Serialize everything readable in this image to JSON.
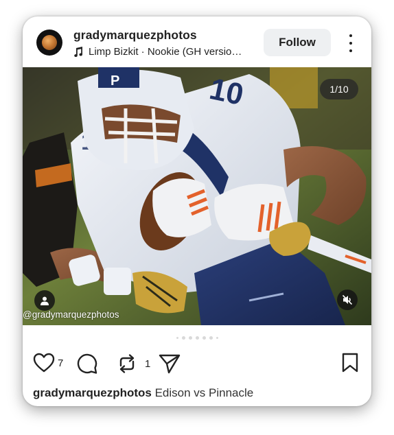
{
  "post": {
    "username": "gradymarquezphotos",
    "music": "Limp Bizkit · Nookie (GH versio…",
    "follow_label": "Follow",
    "image_counter": "1/10",
    "watermark": "@gradymarquezphotos",
    "carousel": {
      "total_dots": 7,
      "active_index": 0
    }
  },
  "actions": {
    "like_count": "7",
    "repost_count": "1"
  },
  "caption": {
    "username": "gradymarquezphotos",
    "text": "Edison vs Pinnacle"
  },
  "icons": [
    "music-note-icon",
    "more-icon",
    "user-tag-icon",
    "mute-icon",
    "heart-icon",
    "comment-icon",
    "repost-icon",
    "share-icon",
    "bookmark-icon"
  ],
  "colors": {
    "text": "#222222",
    "follow_bg": "#eef0f2",
    "jersey_white": "#eef1f6",
    "jersey_navy": "#1f3266"
  }
}
